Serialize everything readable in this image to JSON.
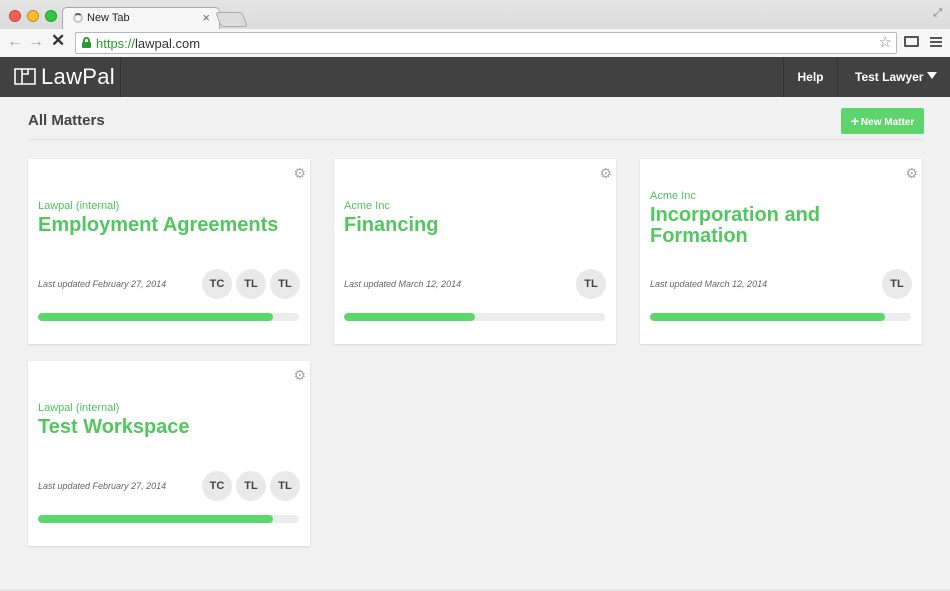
{
  "browser": {
    "tab_title": "New Tab",
    "tab_close": "×",
    "url_scheme": "https://",
    "url_host": "lawpal.com",
    "back": "←",
    "forward": "→",
    "stop": "✕",
    "star": "☆",
    "resize": "⤢"
  },
  "app": {
    "brand": "LawPal",
    "help": "Help",
    "user": "Test Lawyer"
  },
  "page": {
    "title": "All Matters",
    "new_matter_label": "New Matter",
    "new_matter_icon": "+"
  },
  "matters": [
    {
      "client": "Lawpal (internal)",
      "name": "Employment Agreements",
      "updated": "Last updated February 27, 2014",
      "members": [
        "TC",
        "TL",
        "TL"
      ],
      "progress": 0.9
    },
    {
      "client": "Acme Inc",
      "name": "Financing",
      "updated": "Last updated March 12, 2014",
      "members": [
        "TL"
      ],
      "progress": 0.5
    },
    {
      "client": "Acme Inc",
      "name": "Incorporation and Formation",
      "updated": "Last updated March 12, 2014",
      "members": [
        "TL"
      ],
      "progress": 0.9
    },
    {
      "client": "Lawpal (internal)",
      "name": "Test Workspace",
      "updated": "Last updated February 27, 2014",
      "members": [
        "TC",
        "TL",
        "TL"
      ],
      "progress": 0.9
    }
  ],
  "icons": {
    "gear": "gear-icon",
    "spinner": "spinner-icon",
    "lock": "lock-icon"
  },
  "colors": {
    "brand_green": "#52c75f",
    "header_bg": "#414141",
    "progress_fill": "#5ad86a"
  }
}
